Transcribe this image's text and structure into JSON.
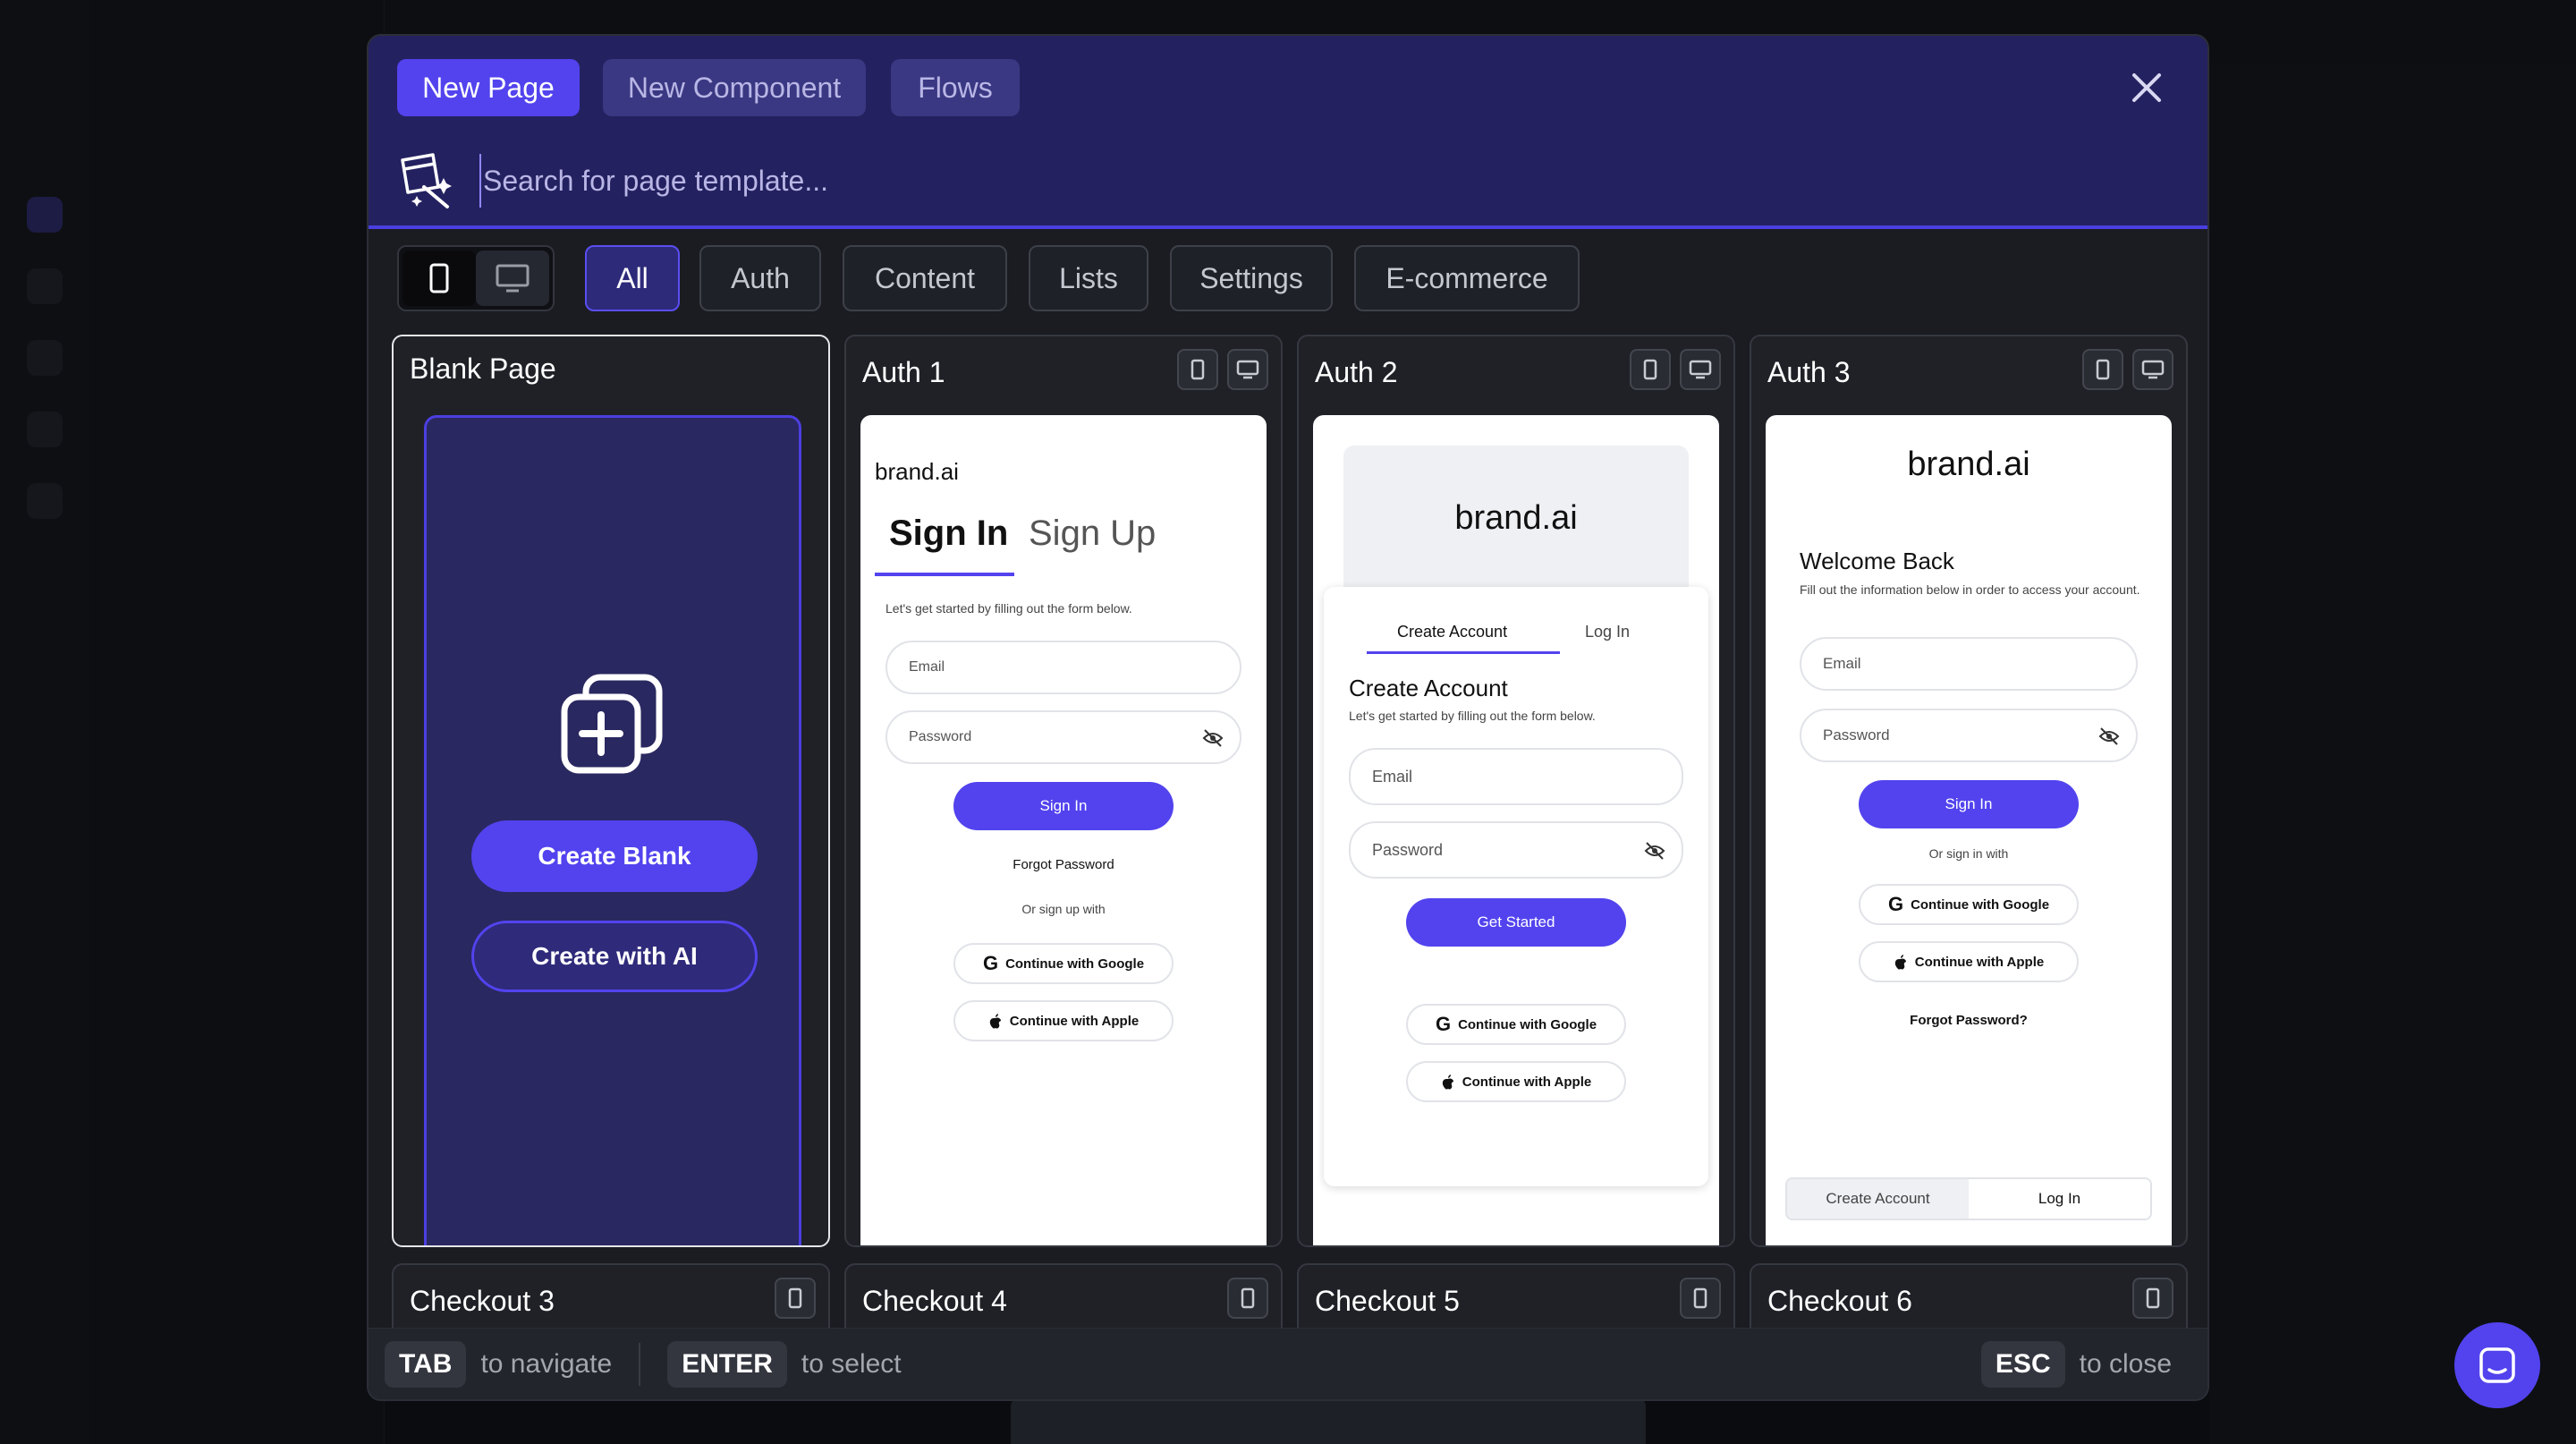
{
  "tabs": [
    "New Page",
    "New Component",
    "Flows"
  ],
  "search": {
    "placeholder": "Search for page template..."
  },
  "filters": [
    "All",
    "Auth",
    "Content",
    "Lists",
    "Settings",
    "E-commerce"
  ],
  "blank": {
    "title": "Blank Page",
    "create_blank": "Create Blank",
    "create_ai": "Create with AI"
  },
  "auth1": {
    "title": "Auth 1",
    "brand": "brand.ai",
    "sign_in": "Sign In",
    "sign_up": "Sign Up",
    "subtitle": "Let's get started by filling out the form below.",
    "email": "Email",
    "password": "Password",
    "button": "Sign In",
    "forgot": "Forgot Password",
    "or": "Or sign up with",
    "google": "Continue with Google",
    "apple": "Continue with Apple"
  },
  "auth2": {
    "title": "Auth 2",
    "brand": "brand.ai",
    "tab_create": "Create Account",
    "tab_login": "Log In",
    "heading": "Create Account",
    "subtitle": "Let's get started by filling out the form below.",
    "email": "Email",
    "password": "Password",
    "button": "Get Started",
    "google": "Continue with Google",
    "apple": "Continue with Apple"
  },
  "auth3": {
    "title": "Auth 3",
    "brand": "brand.ai",
    "heading": "Welcome Back",
    "subtitle": "Fill out the information below in order to access your account.",
    "email": "Email",
    "password": "Password",
    "button": "Sign In",
    "or": "Or sign in with",
    "google": "Continue with Google",
    "apple": "Continue with Apple",
    "forgot": "Forgot Password?",
    "bottom_create": "Create Account",
    "bottom_login": "Log In"
  },
  "row2": [
    "Checkout 3",
    "Checkout 4",
    "Checkout 5",
    "Checkout 6"
  ],
  "footer": {
    "tab_key": "TAB",
    "tab_label": "to navigate",
    "enter_key": "ENTER",
    "enter_label": "to select",
    "esc_key": "ESC",
    "esc_label": "to close"
  },
  "colors": {
    "accent": "#5243ee",
    "header_bg": "#242160"
  }
}
